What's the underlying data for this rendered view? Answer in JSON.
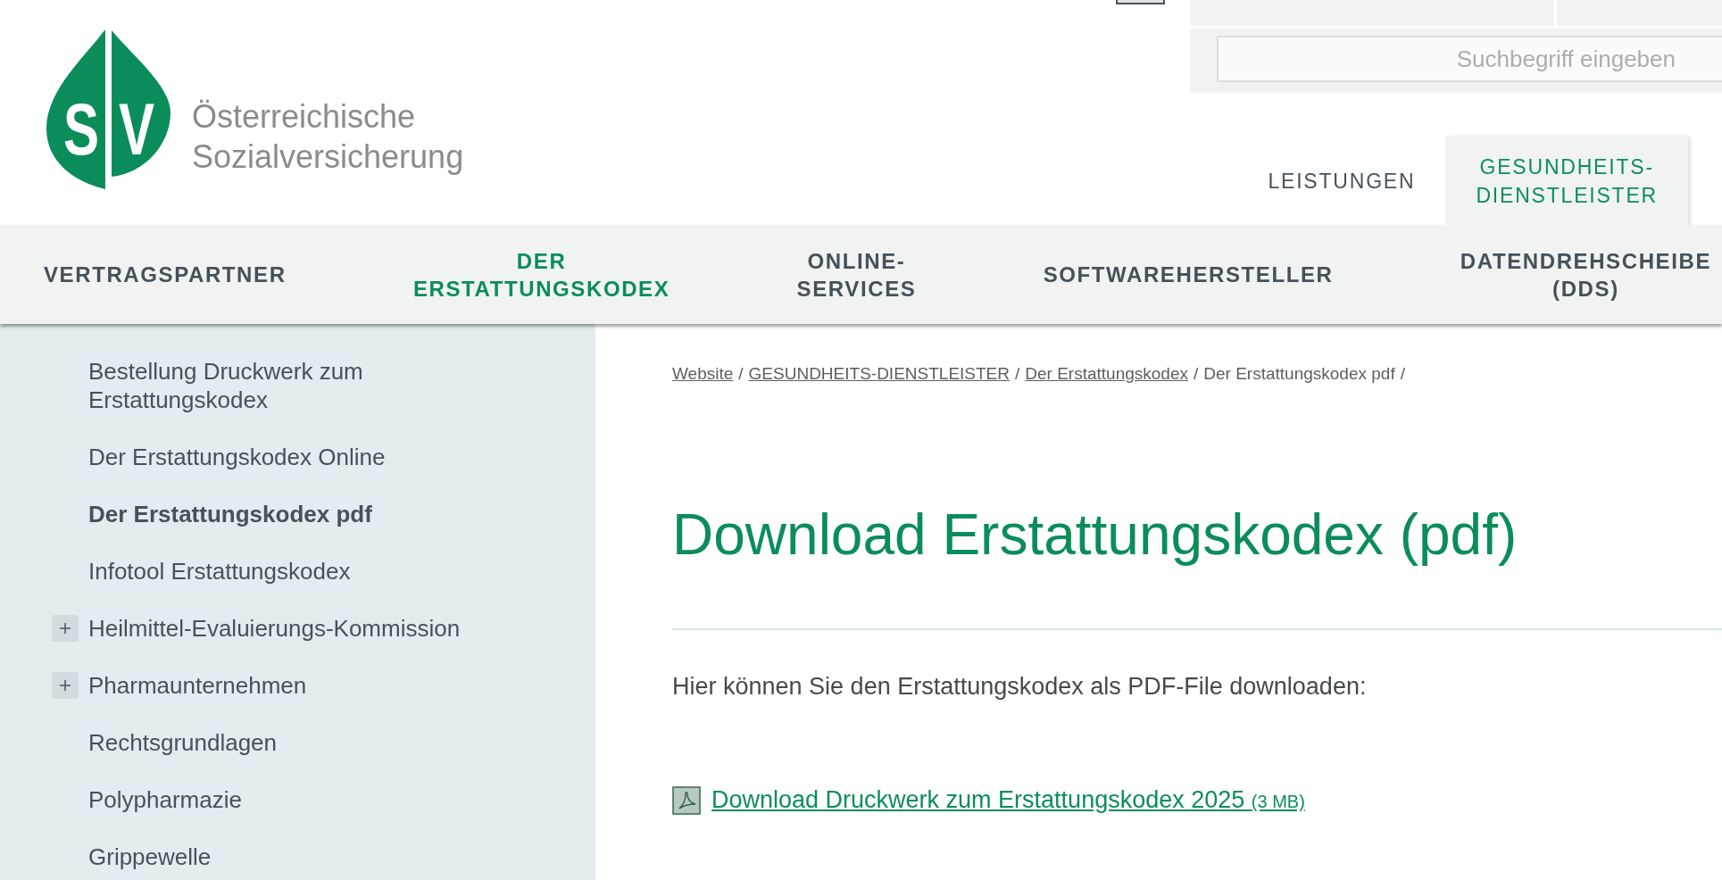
{
  "logo": {
    "letters": [
      "S",
      "V"
    ],
    "name": "Österreichische Sozialversicherung"
  },
  "header": {
    "search": {
      "placeholder": "Suchbegriff eingeben"
    },
    "tabs": [
      {
        "label": "LEISTUNGEN",
        "selected": false
      },
      {
        "label": "GESUNDHEITS-DIENSTLEISTER",
        "selected": true
      }
    ]
  },
  "nav": [
    {
      "label": "VERTRAGSPARTNER",
      "selected": false
    },
    {
      "label": "DER ERSTATTUNGSKODEX",
      "selected": true
    },
    {
      "label": "ONLINE-SERVICES",
      "selected": false
    },
    {
      "label": "SOFTWAREHERSTELLER",
      "selected": false
    },
    {
      "label": "DATENDREHSCHEIBE (DDS)",
      "selected": false
    }
  ],
  "sidebar": {
    "items": [
      {
        "label": "Bestellung Druckwerk zum Erstattungskodex",
        "selected": false,
        "expandable": false
      },
      {
        "label": "Der Erstattungskodex Online",
        "selected": false,
        "expandable": false
      },
      {
        "label": "Der Erstattungskodex pdf",
        "selected": true,
        "expandable": false
      },
      {
        "label": "Infotool Erstattungskodex",
        "selected": false,
        "expandable": false
      },
      {
        "label": "Heilmittel-Evaluierungs-Kommission",
        "selected": false,
        "expandable": true
      },
      {
        "label": "Pharmaunternehmen",
        "selected": false,
        "expandable": true
      },
      {
        "label": "Rechtsgrundlagen",
        "selected": false,
        "expandable": false
      },
      {
        "label": "Polypharmazie",
        "selected": false,
        "expandable": false
      },
      {
        "label": "Grippewelle",
        "selected": false,
        "expandable": false
      }
    ]
  },
  "breadcrumb": [
    {
      "label": "Website",
      "current": false,
      "separator": "/"
    },
    {
      "label": "GESUNDHEITS-DIENSTLEISTER",
      "current": false,
      "separator": "/"
    },
    {
      "label": "Der Erstattungskodex",
      "current": false,
      "separator": "/"
    },
    {
      "label": "Der Erstattungskodex pdf",
      "current": true,
      "separator": "/"
    }
  ],
  "content": {
    "title": "Download Erstattungskodex (pdf)",
    "intro": "Hier können Sie den Erstattungskodex als PDF-File downloaden:",
    "download": {
      "label": "Download Druckwerk zum Erstattungskodex 2025",
      "size": "(3 MB)"
    }
  }
}
